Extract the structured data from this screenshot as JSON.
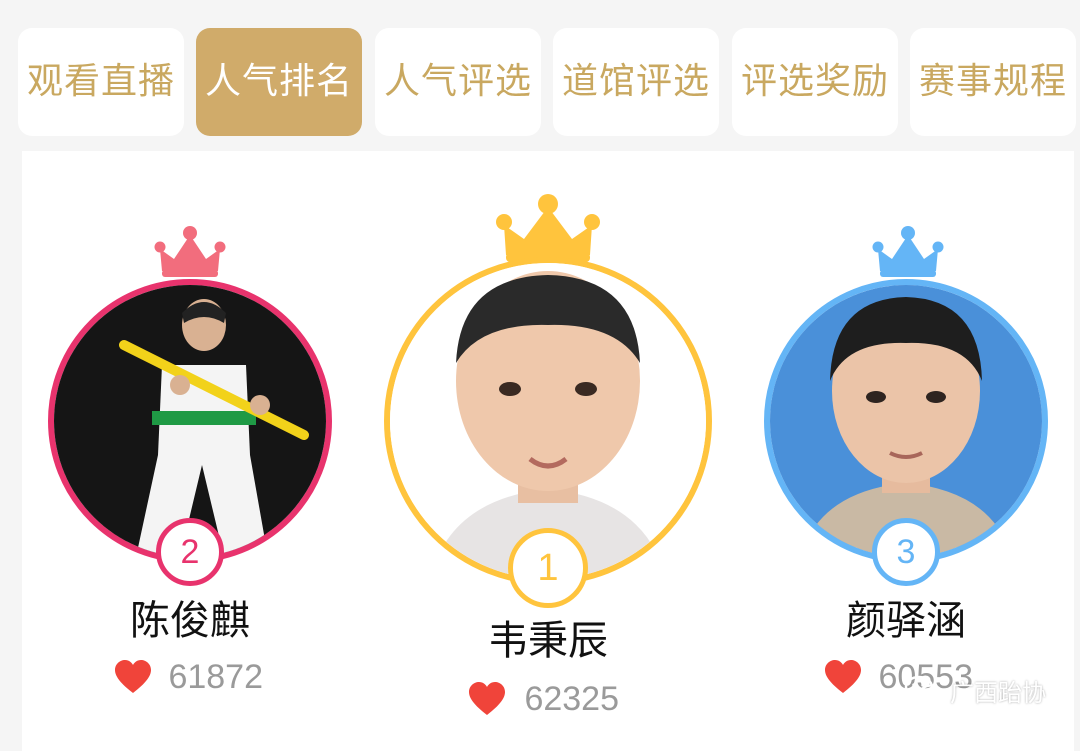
{
  "tabs": [
    {
      "label": "观看直播",
      "active": false
    },
    {
      "label": "人气排名",
      "active": true
    },
    {
      "label": "人气评选",
      "active": false
    },
    {
      "label": "道馆评选",
      "active": false
    },
    {
      "label": "评选奖励",
      "active": false
    },
    {
      "label": "赛事规程",
      "active": false
    }
  ],
  "ranking": {
    "first": {
      "rank": "1",
      "name": "韦秉辰",
      "votes": "62325",
      "color": "#ffc43d"
    },
    "second": {
      "rank": "2",
      "name": "陈俊麒",
      "votes": "61872",
      "color": "#e8336d"
    },
    "third": {
      "rank": "3",
      "name": "颜驿涵",
      "votes": "60553",
      "color": "#64b5f6"
    }
  },
  "icons": {
    "crown": "crown-icon",
    "heart": "heart-icon",
    "wechat": "wechat-icon"
  },
  "colors": {
    "accent": "#d0ab6a",
    "tab_text": "#c9a860",
    "heart": "#f0443a"
  },
  "watermark": {
    "text": "广西跆协"
  }
}
